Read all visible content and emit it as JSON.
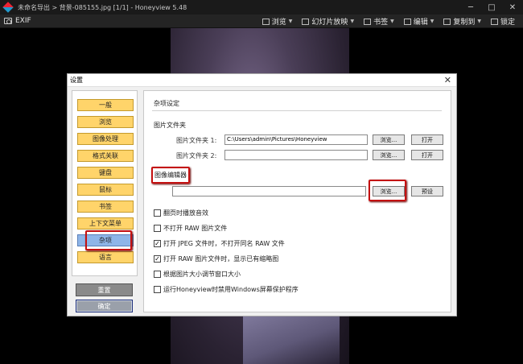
{
  "window": {
    "title": "未命名导出 > 背景-085155.jpg [1/1] - Honeyview 5.48",
    "minimize": "─",
    "maximize": "□",
    "close": "✕"
  },
  "toolbar": {
    "exif_label": "EXIF",
    "menus": [
      {
        "label": "浏览",
        "icon": "browse-icon"
      },
      {
        "label": "幻灯片放映",
        "icon": "slideshow-icon"
      },
      {
        "label": "书签",
        "icon": "bookmark-icon"
      },
      {
        "label": "编辑",
        "icon": "edit-icon"
      },
      {
        "label": "复制到",
        "icon": "copy-icon"
      },
      {
        "label": "锁定",
        "icon": "lock-icon"
      }
    ]
  },
  "dialog": {
    "title": "设置",
    "close": "✕",
    "nav": [
      "一般",
      "浏览",
      "图像处理",
      "格式关联",
      "键盘",
      "鼠标",
      "书签",
      "上下文菜单",
      "杂项",
      "语言"
    ],
    "selected_nav": "杂项",
    "reset_label": "重置",
    "ok_label": "确定",
    "section_title": "杂项设定",
    "pictures_group": "图片文件夹",
    "folder1_label": "图片文件夹 1:",
    "folder1_value": "C:\\Users\\admin\\Pictures\\Honeyview",
    "folder2_label": "图片文件夹 2:",
    "folder2_value": "",
    "browse_label": "浏览...",
    "open_label": "打开",
    "editor_group": "图像编辑器",
    "editor_value": "",
    "preset_label": "预设",
    "options": [
      {
        "label": "翻页时播放音效",
        "checked": false
      },
      {
        "label": "不打开 RAW 图片文件",
        "checked": false
      },
      {
        "label": "打开 JPEG 文件时，不打开同名 RAW 文件",
        "checked": true
      },
      {
        "label": "打开 RAW 图片文件时，显示已有缩略图",
        "checked": true
      },
      {
        "label": "根据图片大小调节窗口大小",
        "checked": false
      },
      {
        "label": "运行Honeyview时禁用Windows屏幕保护程序",
        "checked": false
      }
    ]
  }
}
